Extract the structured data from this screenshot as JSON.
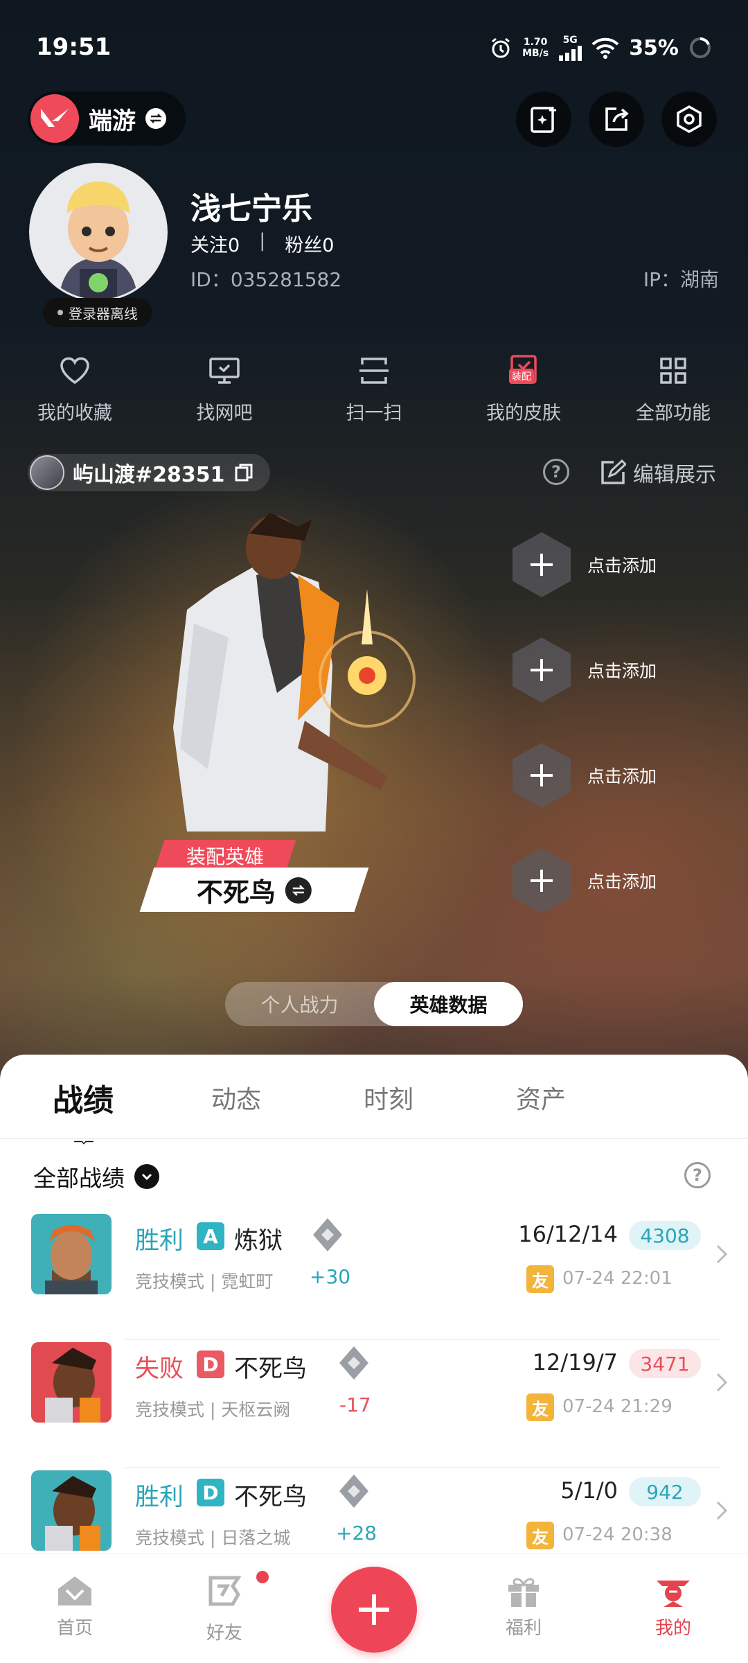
{
  "status_bar": {
    "time": "19:51",
    "speed_value": "1.70",
    "speed_unit": "MB/s",
    "network": "5G",
    "battery": "35%"
  },
  "header": {
    "app_name": "端游"
  },
  "profile": {
    "username": "浅七宁乐",
    "follow_label": "关注",
    "follow_count": "0",
    "fans_label": "粉丝",
    "fans_count": "0",
    "separator": "|",
    "id_text": "ID：035281582",
    "ip_text": "IP：湖南",
    "status_badge": "登录器离线"
  },
  "quick_functions": [
    {
      "label": "我的收藏",
      "icon": "heart-icon"
    },
    {
      "label": "找网吧",
      "icon": "monitor-icon"
    },
    {
      "label": "扫一扫",
      "icon": "scan-icon"
    },
    {
      "label": "我的皮肤",
      "icon": "skin-icon",
      "tag": "装配"
    },
    {
      "label": "全部功能",
      "icon": "grid-icon"
    }
  ],
  "game_account": {
    "name": "屿山渡#28351",
    "edit_label": "编辑展示"
  },
  "hero": {
    "equip_label": "装配英雄",
    "name": "不死鸟",
    "slots": [
      "点击添加",
      "点击添加",
      "点击添加",
      "点击添加"
    ]
  },
  "toggle": {
    "option1": "个人战力",
    "option2": "英雄数据"
  },
  "tabs": [
    "战绩",
    "动态",
    "时刻",
    "资产"
  ],
  "filter": {
    "label": "全部战绩"
  },
  "matches": [
    {
      "result": "胜利",
      "grade": "A",
      "agent": "炼狱",
      "mode": "竞技模式 | 霓虹町",
      "delta": "+30",
      "kda": "16/12/14",
      "score": "4308",
      "friend": "友",
      "time": "07-24 22:01"
    },
    {
      "result": "失败",
      "grade": "D",
      "agent": "不死鸟",
      "mode": "竞技模式 | 天枢云阙",
      "delta": "-17",
      "kda": "12/19/7",
      "score": "3471",
      "friend": "友",
      "time": "07-24 21:29"
    },
    {
      "result": "胜利",
      "grade": "D",
      "agent": "不死鸟",
      "mode": "竞技模式 | 日落之城",
      "delta": "+28",
      "kda": "5/1/0",
      "score": "942",
      "friend": "友",
      "time": "07-24 20:38"
    }
  ],
  "bottom_nav": {
    "home": "首页",
    "friends": "好友",
    "welfare": "福利",
    "mine": "我的"
  },
  "colors": {
    "accent": "#ee4656",
    "win": "#2aa5b8",
    "lose": "#e9505a"
  }
}
